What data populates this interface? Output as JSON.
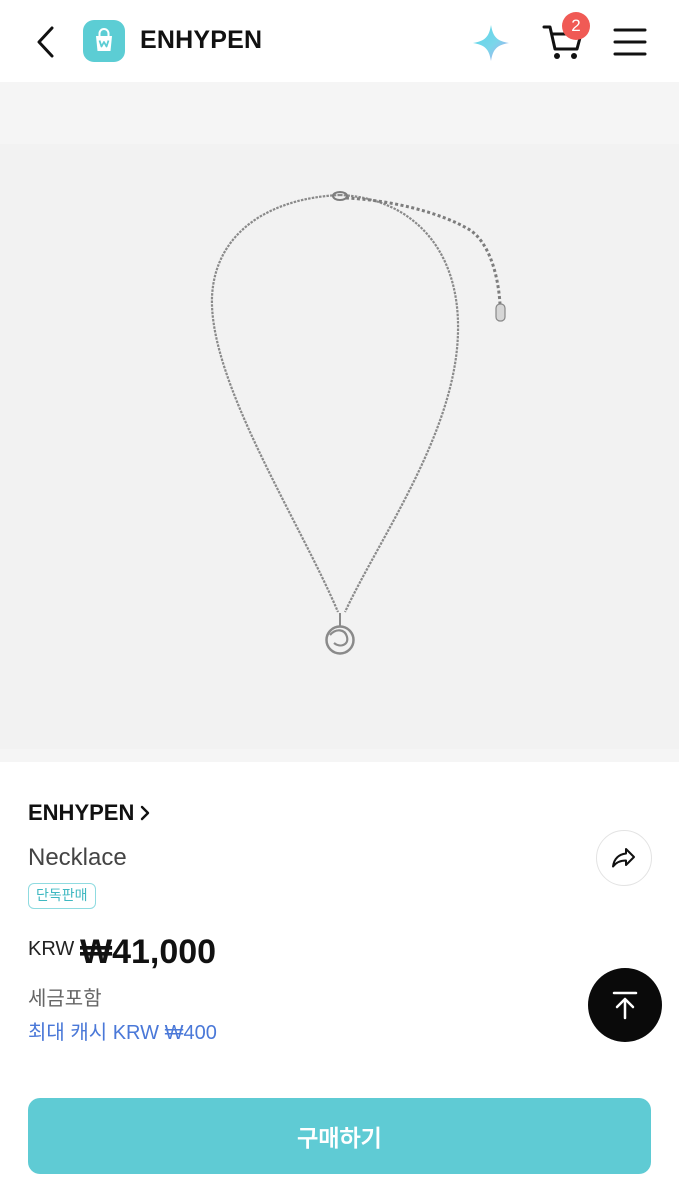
{
  "header": {
    "title": "ENHYPEN",
    "cart_count": "2",
    "icons": [
      "chevron-left-icon",
      "shop-bag-logo-icon",
      "sparkle-icon",
      "cart-icon",
      "hamburger-menu-icon"
    ]
  },
  "product": {
    "brand": "ENHYPEN",
    "name": "Necklace",
    "tag": "단독판매",
    "currency": "KRW",
    "price": "₩41,000",
    "tax_note": "세금포함",
    "cash_note": "최대 캐시 KRW ₩400"
  },
  "actions": {
    "buy_label": "구매하기"
  },
  "colors": {
    "accent": "#5fcbd4",
    "badge": "#f05a55",
    "link_blue": "#4a78d8"
  }
}
